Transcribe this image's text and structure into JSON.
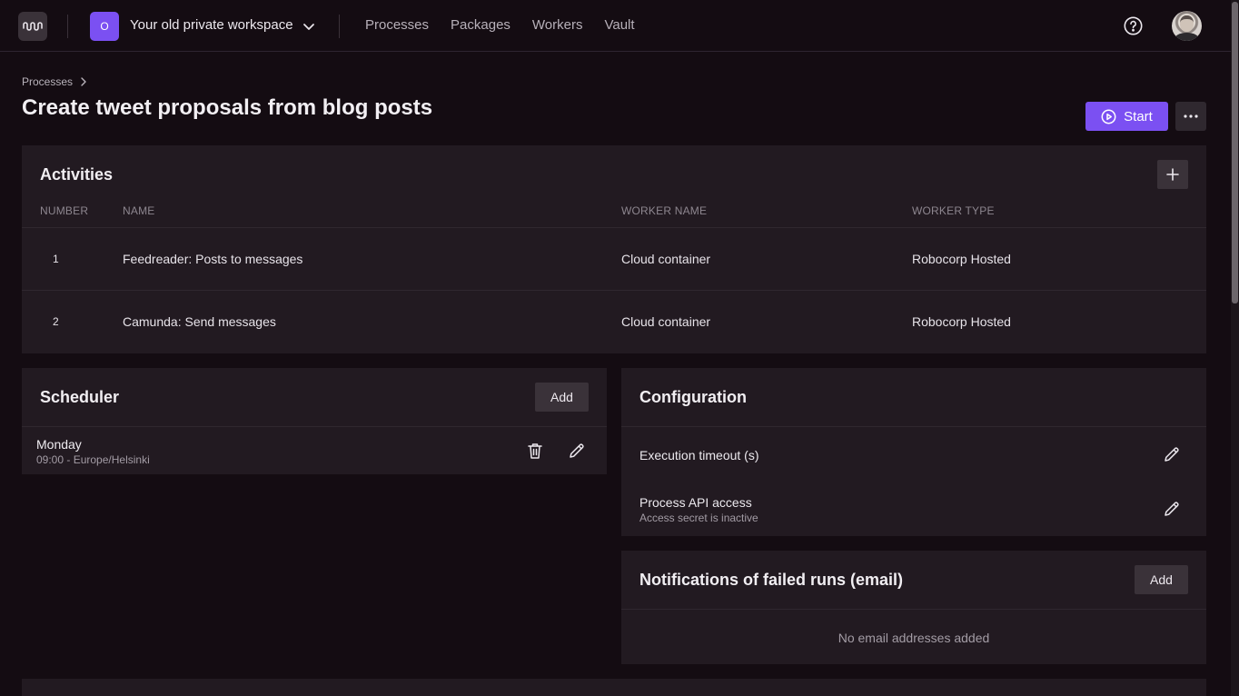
{
  "topbar": {
    "workspace_initial": "O",
    "workspace_name": "Your old private workspace",
    "nav": [
      "Processes",
      "Packages",
      "Workers",
      "Vault"
    ]
  },
  "header": {
    "breadcrumb": "Processes",
    "title": "Create tweet proposals from blog posts",
    "start_label": "Start"
  },
  "activities": {
    "title": "Activities",
    "columns": [
      "NUMBER",
      "NAME",
      "WORKER NAME",
      "WORKER TYPE"
    ],
    "rows": [
      {
        "number": "1",
        "name": "Feedreader: Posts to messages",
        "worker_name": "Cloud container",
        "worker_type": "Robocorp Hosted"
      },
      {
        "number": "2",
        "name": "Camunda: Send messages",
        "worker_name": "Cloud container",
        "worker_type": "Robocorp Hosted"
      }
    ]
  },
  "scheduler": {
    "title": "Scheduler",
    "add_label": "Add",
    "items": [
      {
        "day": "Monday",
        "time": "09:00 - Europe/Helsinki"
      }
    ]
  },
  "configuration": {
    "title": "Configuration",
    "items": [
      {
        "label": "Execution timeout (s)",
        "sub": ""
      },
      {
        "label": "Process API access",
        "sub": "Access secret is inactive"
      }
    ]
  },
  "notifications": {
    "title": "Notifications of failed runs (email)",
    "add_label": "Add",
    "empty_text": "No email addresses added"
  },
  "colors": {
    "accent": "#7b50f2",
    "background": "#140c12",
    "panel": "#221a21"
  }
}
